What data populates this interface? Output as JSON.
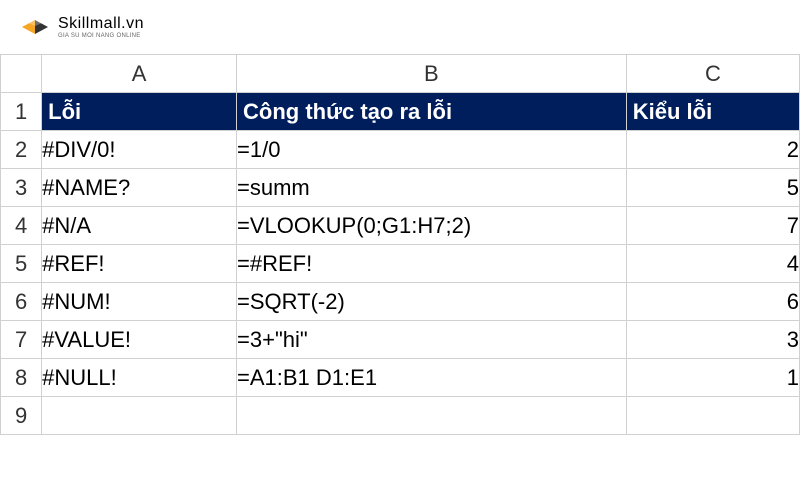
{
  "logo": {
    "title": "Skillmall.vn",
    "subtitle": "GIA SU MOI NANG ONLINE"
  },
  "columns": [
    "A",
    "B",
    "C"
  ],
  "headers": {
    "col_a": "Lỗi",
    "col_b": "Công thức tạo ra lỗi",
    "col_c": "Kiểu lỗi"
  },
  "chart_data": {
    "type": "table",
    "columns": [
      "Lỗi",
      "Công thức tạo ra lỗi",
      "Kiểu lỗi"
    ],
    "rows": [
      {
        "error": "#DIV/0!",
        "formula": "=1/0",
        "type": 2
      },
      {
        "error": "#NAME?",
        "formula": "=summ",
        "type": 5
      },
      {
        "error": "#N/A",
        "formula": "=VLOOKUP(0;G1:H7;2)",
        "type": 7
      },
      {
        "error": "#REF!",
        "formula": "=#REF!",
        "type": 4
      },
      {
        "error": "#NUM!",
        "formula": "=SQRT(-2)",
        "type": 6
      },
      {
        "error": "#VALUE!",
        "formula": "=3+\"hi\"",
        "type": 3
      },
      {
        "error": "#NULL!",
        "formula": "=A1:B1 D1:E1",
        "type": 1
      }
    ]
  },
  "row_numbers": [
    "1",
    "2",
    "3",
    "4",
    "5",
    "6",
    "7",
    "8",
    "9"
  ]
}
